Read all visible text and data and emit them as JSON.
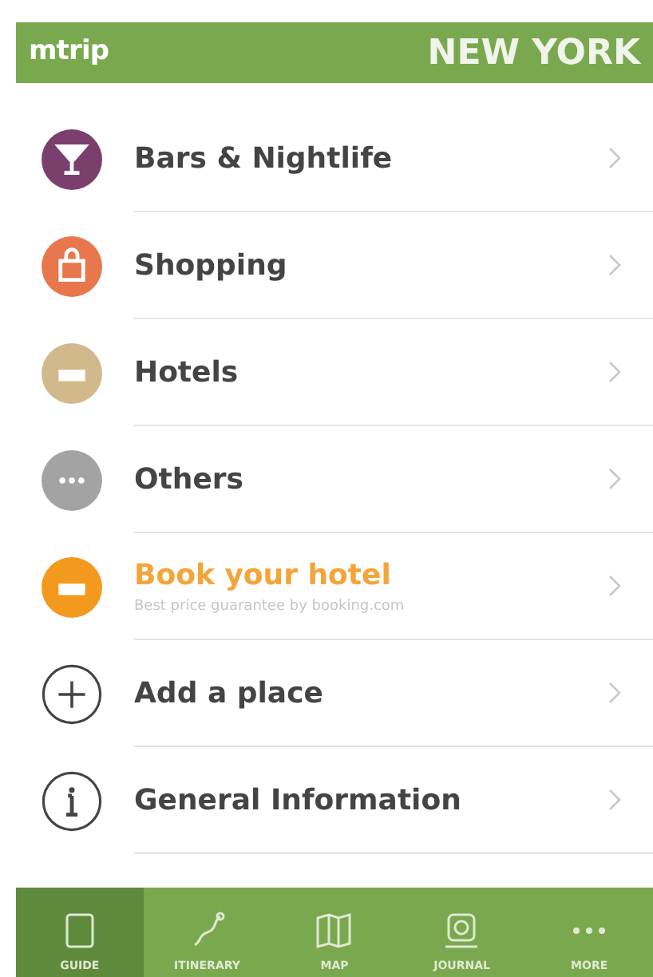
{
  "header": {
    "logo": "mtrip",
    "city": "NEW YORK"
  },
  "items": [
    {
      "kind": "category",
      "label": "Bars & Nightlife",
      "color": "#7b3f6e"
    },
    {
      "kind": "category",
      "label": "Shopping",
      "color": "#e8774e"
    },
    {
      "kind": "category",
      "label": "Hotels",
      "color": "#d2b98c"
    },
    {
      "kind": "category",
      "label": "Others",
      "color": "#a3a3a3"
    },
    {
      "kind": "promo",
      "label": "Book your hotel",
      "subtitle": "Best price guarantee by booking.com",
      "color": "#f39a1e"
    },
    {
      "kind": "outline",
      "label": "Add a place"
    },
    {
      "kind": "outline",
      "label": "General Information"
    }
  ],
  "tabs": [
    {
      "label": "GUIDE",
      "selected": true
    },
    {
      "label": "ITINERARY",
      "selected": false
    },
    {
      "label": "MAP",
      "selected": false
    },
    {
      "label": "JOURNAL",
      "selected": false
    },
    {
      "label": "MORE",
      "selected": false
    }
  ]
}
